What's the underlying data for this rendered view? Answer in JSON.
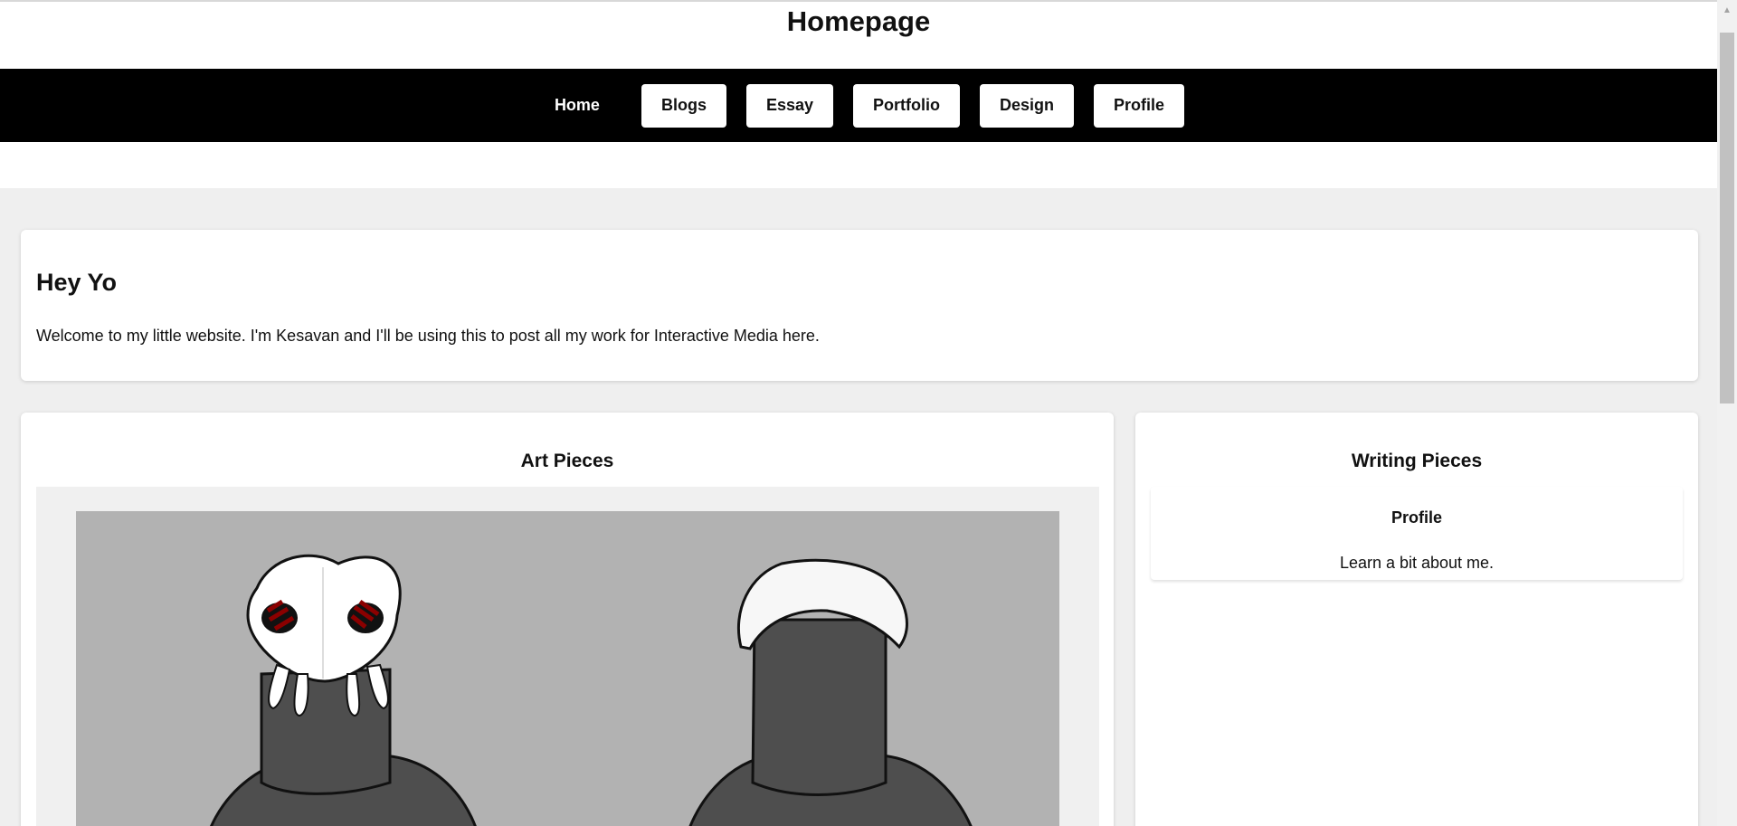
{
  "header": {
    "title": "Homepage"
  },
  "nav": {
    "items": [
      {
        "label": "Home",
        "active": true
      },
      {
        "label": "Blogs"
      },
      {
        "label": "Essay"
      },
      {
        "label": "Portfolio"
      },
      {
        "label": "Design"
      },
      {
        "label": "Profile"
      }
    ]
  },
  "intro": {
    "heading": "Hey Yo",
    "text": "Welcome to my little website. I'm Kesavan and I'll be using this to post all my work for Interactive Media here."
  },
  "art": {
    "title": "Art Pieces"
  },
  "writing": {
    "title": "Writing Pieces",
    "items": [
      {
        "title": "Profile",
        "description": "Learn a bit about me."
      }
    ]
  },
  "colors": {
    "nav_bg": "#000000",
    "page_bg": "#efefef",
    "card_bg": "#ffffff",
    "art_bg": "#b2b2b2",
    "figure_dark": "#4e4e4e",
    "eye_red": "#8b0000"
  },
  "icons": {
    "scroll_up": "chevron-up-icon"
  }
}
